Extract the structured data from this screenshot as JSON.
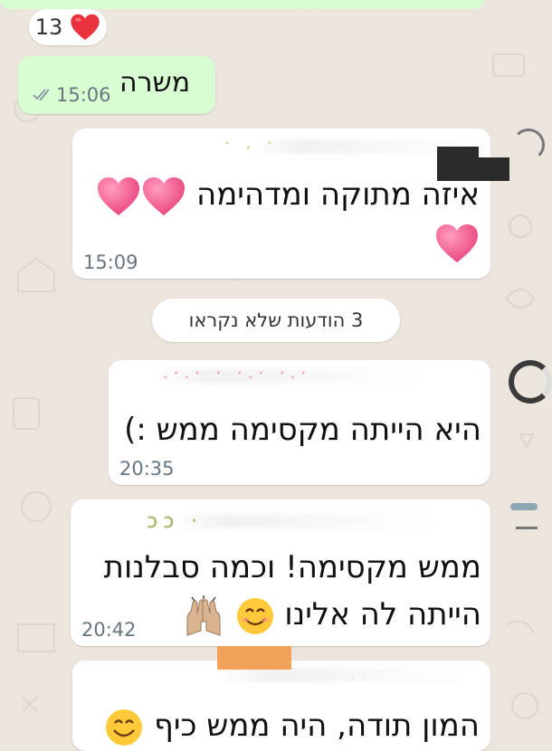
{
  "reaction": {
    "count": "13",
    "emoji": "heart"
  },
  "messages": [
    {
      "direction": "out",
      "text": "משרה",
      "time": "15:06",
      "status": "read-double-check"
    },
    {
      "direction": "in",
      "text": "איזה מתוקה ומדהימה",
      "emoji_after": [
        "heart",
        "heart",
        "heart"
      ],
      "time": "15:09"
    },
    {
      "direction": "in",
      "text": "היא הייתה מקסימה ממש :)",
      "time": "20:35"
    },
    {
      "direction": "in",
      "text_line1": "ממש מקסימה! וכמה סבלנות",
      "text_line2": "הייתה לה אלינו",
      "emoji_after": [
        "smiling-face",
        "raising-hands"
      ],
      "time": "20:42"
    },
    {
      "direction": "in",
      "text": "המון תודה, היה ממש כיף",
      "emoji_after": [
        "smiling-face"
      ]
    }
  ],
  "unread_divider": "3 הודעות שלא נקראו",
  "colors": {
    "chat_background": "#ECE5DD",
    "outgoing_bubble": "#D9FDD3",
    "incoming_bubble": "#FFFFFF",
    "timestamp": "#667781",
    "read_ticks": "#8696A0",
    "heart": "#F0568C"
  }
}
